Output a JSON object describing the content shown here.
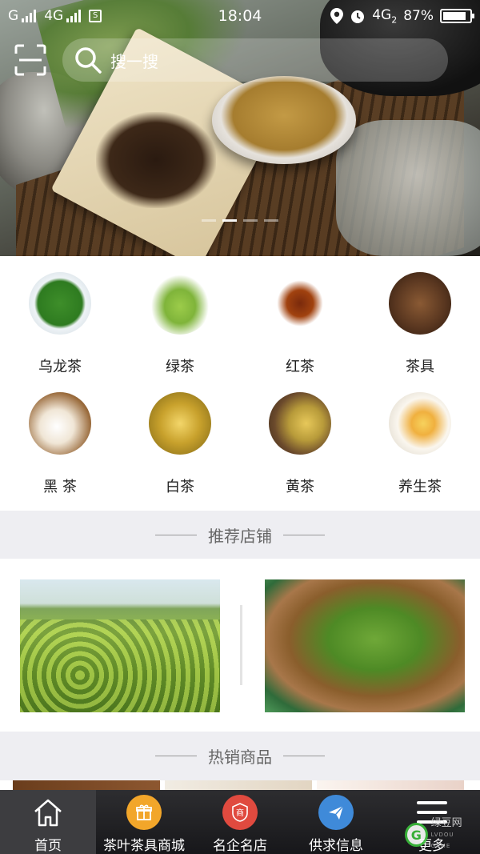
{
  "statusbar": {
    "carrier1": "G",
    "carrier2": "4G",
    "sim_badge": "S",
    "time": "18:04",
    "network": "4G",
    "network_sub": "2",
    "battery_percent": "87%",
    "battery_level": 0.87
  },
  "search": {
    "placeholder": "搜一搜"
  },
  "banner": {
    "slide_count": 4,
    "active_slide": 2
  },
  "categories": [
    {
      "label": "乌龙茶"
    },
    {
      "label": "绿茶"
    },
    {
      "label": "红茶"
    },
    {
      "label": "茶具"
    },
    {
      "label": "黑 茶"
    },
    {
      "label": "白茶"
    },
    {
      "label": "黄茶"
    },
    {
      "label": "养生茶"
    }
  ],
  "sections": {
    "stores_title": "推荐店铺",
    "products_title": "热销商品"
  },
  "tabbar": {
    "items": [
      {
        "label": "首页",
        "icon": "home-icon",
        "active": true
      },
      {
        "label": "茶叶茶具商城",
        "icon": "gift-icon",
        "active": false
      },
      {
        "label": "名企名店",
        "icon": "shop-icon",
        "active": false
      },
      {
        "label": "供求信息",
        "icon": "send-icon",
        "active": false
      },
      {
        "label": "更多",
        "icon": "menu-icon",
        "active": false
      }
    ]
  },
  "watermark": {
    "brand": "绿豆网",
    "sub": "LVDOU GAME",
    "logo_letter": "G"
  },
  "colors": {
    "tab_orange": "#f2a62a",
    "tab_red": "#e04a3f",
    "tab_blue": "#3f8ad9",
    "section_bg": "#eeeef2"
  }
}
